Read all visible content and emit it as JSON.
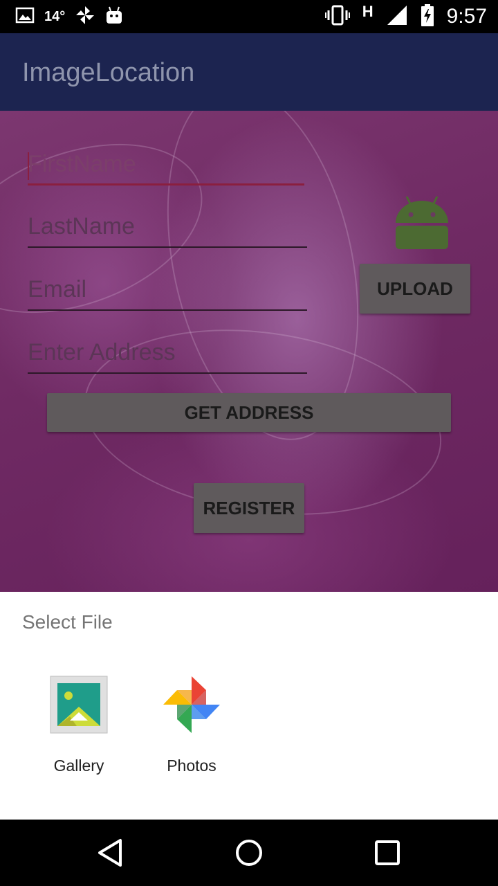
{
  "status_bar": {
    "temperature": "14°",
    "network_type": "H",
    "time": "9:57",
    "icons": [
      "image-icon",
      "pinwheel-icon",
      "android-icon",
      "vibrate-icon",
      "signal-icon",
      "battery-charging-icon"
    ]
  },
  "app_bar": {
    "title": "ImageLocation"
  },
  "form": {
    "first_name_placeholder": "FirstName",
    "last_name_placeholder": "LastName",
    "email_placeholder": "Email",
    "address_placeholder": "Enter Address",
    "upload_label": "UPLOAD",
    "get_address_label": "GET ADDRESS",
    "register_label": "REGISTER"
  },
  "sheet": {
    "title": "Select File",
    "apps": [
      {
        "label": "Gallery",
        "icon": "gallery-icon"
      },
      {
        "label": "Photos",
        "icon": "photos-icon"
      }
    ]
  },
  "nav_bar": {
    "buttons": [
      "back-icon",
      "home-icon",
      "recents-icon"
    ]
  },
  "colors": {
    "app_bar": "#1c2450",
    "background": "#74306a",
    "button": "#5f5a5c",
    "accent": "#8a1f3f"
  }
}
